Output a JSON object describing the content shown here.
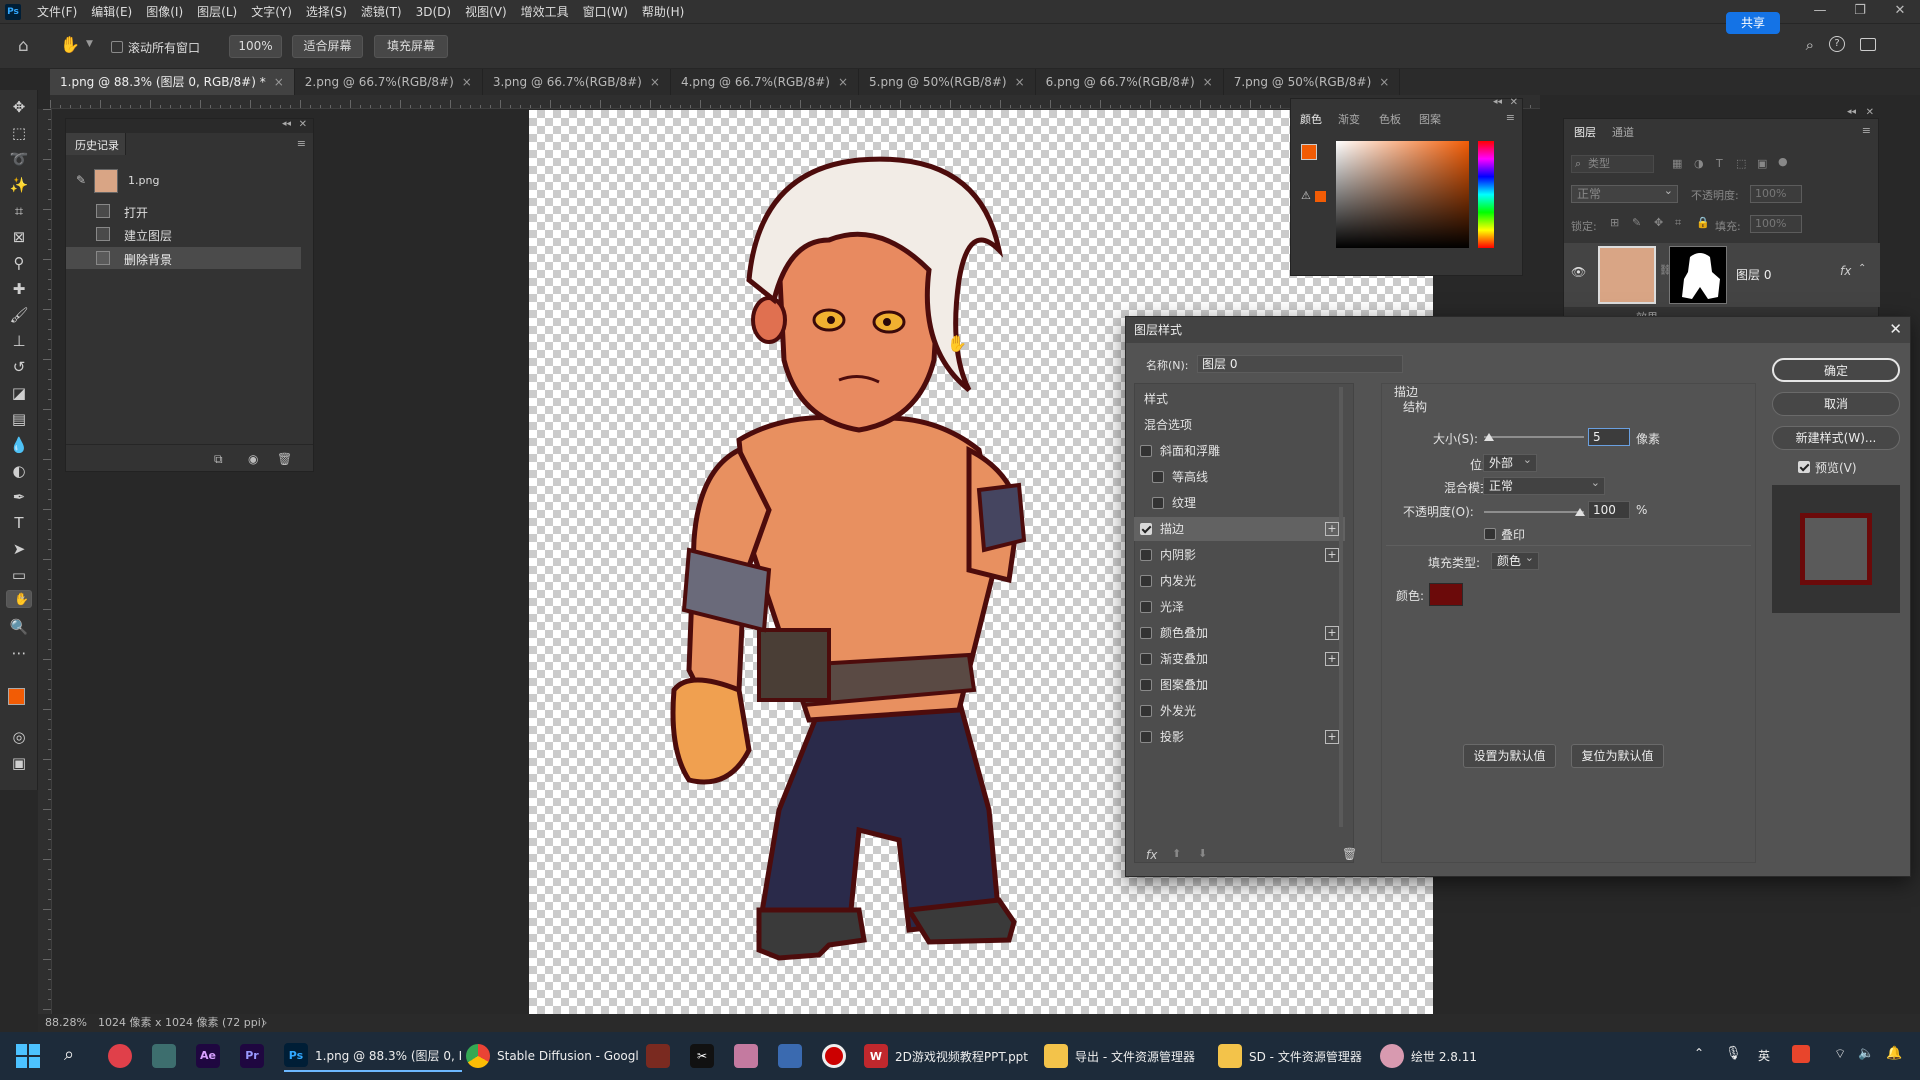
{
  "app": {
    "logo": "Ps"
  },
  "menu": [
    "文件(F)",
    "编辑(E)",
    "图像(I)",
    "图层(L)",
    "文字(Y)",
    "选择(S)",
    "滤镜(T)",
    "3D(D)",
    "视图(V)",
    "增效工具",
    "窗口(W)",
    "帮助(H)"
  ],
  "options": {
    "scroll_all_label": "滚动所有窗口",
    "zoom_btn": "100%",
    "fit_screen": "适合屏幕",
    "fill_screen": "填充屏幕",
    "share": "共享"
  },
  "tabs": [
    "1.png @ 88.3% (图层 0, RGB/8#) *",
    "2.png @ 66.7%(RGB/8#)",
    "3.png @ 66.7%(RGB/8#)",
    "4.png @ 66.7%(RGB/8#)",
    "5.png @ 50%(RGB/8#)",
    "6.png @ 66.7%(RGB/8#)",
    "7.png @ 50%(RGB/8#)"
  ],
  "history": {
    "title": "历史记录",
    "snapshot": "1.png",
    "items": [
      "打开",
      "建立图层",
      "删除背景"
    ]
  },
  "color_panel": {
    "tabs": [
      "颜色",
      "渐变",
      "色板",
      "图案"
    ],
    "fg_color": "#f25c05",
    "bg_color": "#000000"
  },
  "layers_panel": {
    "tabs": [
      "图层",
      "通道"
    ],
    "search_placeholder": "类型",
    "blend": "正常",
    "opacity_label": "不透明度:",
    "opacity": "100%",
    "lock_label": "锁定:",
    "fill_label": "填充:",
    "fill": "100%",
    "layer_name": "图层 0",
    "effects_label": "效果"
  },
  "dialog": {
    "title": "图层样式",
    "name_label": "名称(N):",
    "name_value": "图层 0",
    "styles_header": "样式",
    "blend_options": "混合选项",
    "styles": [
      {
        "label": "斜面和浮雕",
        "checked": false,
        "plus": false
      },
      {
        "label": "等高线",
        "checked": false,
        "plus": false,
        "sub": true
      },
      {
        "label": "纹理",
        "checked": false,
        "plus": false,
        "sub": true
      },
      {
        "label": "描边",
        "checked": true,
        "plus": true
      },
      {
        "label": "内阴影",
        "checked": false,
        "plus": true
      },
      {
        "label": "内发光",
        "checked": false,
        "plus": false
      },
      {
        "label": "光泽",
        "checked": false,
        "plus": false
      },
      {
        "label": "颜色叠加",
        "checked": false,
        "plus": true
      },
      {
        "label": "渐变叠加",
        "checked": false,
        "plus": true
      },
      {
        "label": "图案叠加",
        "checked": false,
        "plus": false
      },
      {
        "label": "外发光",
        "checked": false,
        "plus": false
      },
      {
        "label": "投影",
        "checked": false,
        "plus": true
      }
    ],
    "stroke": {
      "section": "描边",
      "structure": "结构",
      "size_label": "大小(S):",
      "size_value": "5",
      "size_unit": "像素",
      "position_label": "位置:",
      "position_value": "外部",
      "blend_label": "混合模式:",
      "blend_value": "正常",
      "opacity_label": "不透明度(O):",
      "opacity_value": "100",
      "opacity_unit": "%",
      "overprint_label": "叠印",
      "fill_type_label": "填充类型:",
      "fill_type_value": "颜色",
      "color_label": "颜色:",
      "color": "#6b0a0a"
    },
    "set_default": "设置为默认值",
    "reset_default": "复位为默认值",
    "ok": "确定",
    "cancel": "取消",
    "new_style": "新建样式(W)...",
    "preview_label": "预览(V)"
  },
  "status": {
    "zoom": "88.28%",
    "doc_info": "1024 像素 x 1024 像素 (72 ppi)"
  },
  "taskbar": {
    "items": [
      {
        "label": "1.png @ 88.3% (图层 0, I",
        "icon": "Ps"
      },
      {
        "label": "Stable Diffusion - Googl",
        "icon": "chrome"
      },
      {
        "label": "2D游戏视频教程PPT.ppt",
        "icon": "W"
      },
      {
        "label": "导出 - 文件资源管理器",
        "icon": "folder"
      },
      {
        "label": "SD - 文件资源管理器",
        "icon": "folder"
      },
      {
        "label": "绘世 2.8.11",
        "icon": "app"
      }
    ],
    "tray_lang": "英"
  }
}
